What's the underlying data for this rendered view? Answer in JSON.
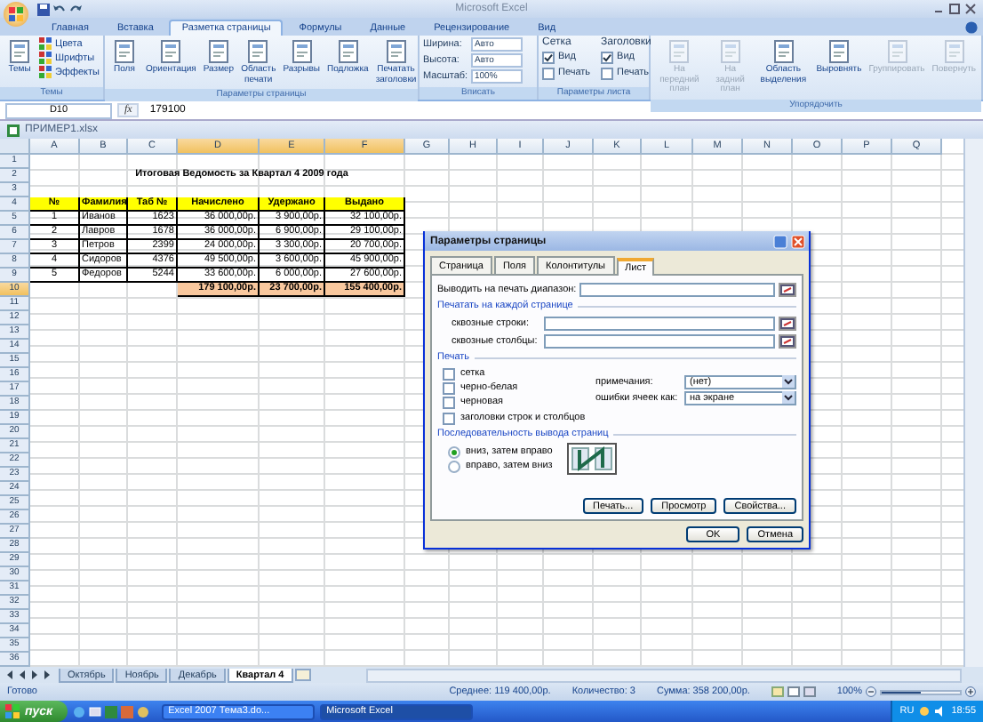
{
  "window": {
    "title": "Microsoft Excel"
  },
  "ribbon": {
    "tabs": [
      {
        "label": "Главная",
        "selected": false
      },
      {
        "label": "Вставка",
        "selected": false
      },
      {
        "label": "Разметка страницы",
        "selected": true
      },
      {
        "label": "Формулы",
        "selected": false
      },
      {
        "label": "Данные",
        "selected": false
      },
      {
        "label": "Рецензирование",
        "selected": false
      },
      {
        "label": "Вид",
        "selected": false
      }
    ],
    "groups": [
      {
        "label": "Темы",
        "items": [
          {
            "kind": "large",
            "label": "Темы",
            "disabled": false
          },
          {
            "kind": "stack",
            "items": [
              {
                "label": "Цвета"
              },
              {
                "label": "Шрифты"
              },
              {
                "label": "Эффекты"
              }
            ]
          }
        ]
      },
      {
        "label": "Параметры страницы",
        "items": [
          {
            "kind": "large",
            "label": "Поля",
            "disabled": false
          },
          {
            "kind": "large",
            "label": "Ориентация",
            "disabled": false
          },
          {
            "kind": "large",
            "label": "Размер",
            "disabled": false
          },
          {
            "kind": "large",
            "label": "Область печати",
            "disabled": false
          },
          {
            "kind": "large",
            "label": "Разрывы",
            "disabled": false
          },
          {
            "kind": "large",
            "label": "Подложка",
            "disabled": false
          },
          {
            "kind": "large",
            "label": "Печатать заголовки",
            "disabled": false
          }
        ]
      },
      {
        "label": "Вписать",
        "items": [
          {
            "kind": "fields",
            "items": [
              {
                "label": "Ширина:",
                "value": "Авто"
              },
              {
                "label": "Высота:",
                "value": "Авто"
              },
              {
                "label": "Масштаб:",
                "value": "100%"
              }
            ]
          }
        ]
      },
      {
        "label": "Параметры листа",
        "items": [
          {
            "kind": "checks",
            "heading": "Сетка",
            "items": [
              {
                "label": "Вид",
                "checked": true
              },
              {
                "label": "Печать",
                "checked": false
              }
            ]
          },
          {
            "kind": "checks",
            "heading": "Заголовки",
            "items": [
              {
                "label": "Вид",
                "checked": true
              },
              {
                "label": "Печать",
                "checked": false
              }
            ]
          }
        ]
      },
      {
        "label": "Упорядочить",
        "items": [
          {
            "kind": "large",
            "label": "На передний план",
            "disabled": true
          },
          {
            "kind": "large",
            "label": "На задний план",
            "disabled": true
          },
          {
            "kind": "large",
            "label": "Область выделения",
            "disabled": false
          },
          {
            "kind": "large",
            "label": "Выровнять",
            "disabled": false
          },
          {
            "kind": "large",
            "label": "Группировать",
            "disabled": true
          },
          {
            "kind": "large",
            "label": "Повернуть",
            "disabled": true
          }
        ]
      }
    ]
  },
  "formula_bar": {
    "name_box": "D10",
    "fx": "fx",
    "value": "179100"
  },
  "workbook": {
    "title": "ПРИМЕР1.xlsx"
  },
  "sheet": {
    "columns": [
      {
        "label": "A",
        "selected": false
      },
      {
        "label": "B",
        "selected": false
      },
      {
        "label": "C",
        "selected": false
      },
      {
        "label": "D",
        "selected": true
      },
      {
        "label": "E",
        "selected": true
      },
      {
        "label": "F",
        "selected": true
      },
      {
        "label": "G",
        "selected": false
      },
      {
        "label": "H",
        "selected": false
      },
      {
        "label": "I",
        "selected": false
      },
      {
        "label": "J",
        "selected": false
      },
      {
        "label": "K",
        "selected": false
      },
      {
        "label": "L",
        "selected": false
      },
      {
        "label": "M",
        "selected": false
      },
      {
        "label": "N",
        "selected": false
      },
      {
        "label": "O",
        "selected": false
      },
      {
        "label": "P",
        "selected": false
      },
      {
        "label": "Q",
        "selected": false
      }
    ],
    "rows": [
      {
        "number": "1",
        "kind": "blank",
        "selected": false
      },
      {
        "number": "2",
        "kind": "title",
        "selected": false,
        "title": "Итоговая Ведомость за Квартал 4 2009 года"
      },
      {
        "number": "3",
        "kind": "blank",
        "selected": false
      },
      {
        "number": "4",
        "kind": "header",
        "selected": false,
        "cells": [
          "№",
          "Фамилия",
          "Таб №",
          "Начислено",
          "Удержано",
          "Выдано"
        ]
      },
      {
        "number": "5",
        "kind": "data",
        "selected": false,
        "cells": [
          "1",
          "Иванов",
          "1623",
          "36 000,00р.",
          "3 900,00р.",
          "32 100,00р."
        ]
      },
      {
        "number": "6",
        "kind": "data",
        "selected": false,
        "cells": [
          "2",
          "Лавров",
          "1678",
          "36 000,00р.",
          "6 900,00р.",
          "29 100,00р."
        ]
      },
      {
        "number": "7",
        "kind": "data",
        "selected": false,
        "cells": [
          "3",
          "Петров",
          "2399",
          "24 000,00р.",
          "3 300,00р.",
          "20 700,00р."
        ]
      },
      {
        "number": "8",
        "kind": "data",
        "selected": false,
        "cells": [
          "4",
          "Сидоров",
          "4376",
          "49 500,00р.",
          "3 600,00р.",
          "45 900,00р."
        ]
      },
      {
        "number": "9",
        "kind": "data",
        "selected": false,
        "cells": [
          "5",
          "Федоров",
          "5244",
          "33 600,00р.",
          "6 000,00р.",
          "27 600,00р."
        ]
      },
      {
        "number": "10",
        "kind": "total",
        "selected": true,
        "cells": [
          "179 100,00р.",
          "23 700,00р.",
          "155 400,00р."
        ]
      },
      {
        "number": "11",
        "kind": "blank",
        "selected": false
      },
      {
        "number": "12",
        "kind": "blank",
        "selected": false
      },
      {
        "number": "13",
        "kind": "blank",
        "selected": false
      },
      {
        "number": "14",
        "kind": "blank",
        "selected": false
      },
      {
        "number": "15",
        "kind": "blank",
        "selected": false
      },
      {
        "number": "16",
        "kind": "blank",
        "selected": false
      },
      {
        "number": "17",
        "kind": "blank",
        "selected": false
      },
      {
        "number": "18",
        "kind": "blank",
        "selected": false
      },
      {
        "number": "19",
        "kind": "blank",
        "selected": false
      },
      {
        "number": "20",
        "kind": "blank",
        "selected": false
      },
      {
        "number": "21",
        "kind": "blank",
        "selected": false
      },
      {
        "number": "22",
        "kind": "blank",
        "selected": false
      },
      {
        "number": "23",
        "kind": "blank",
        "selected": false
      },
      {
        "number": "24",
        "kind": "blank",
        "selected": false
      },
      {
        "number": "25",
        "kind": "blank",
        "selected": false
      },
      {
        "number": "26",
        "kind": "blank",
        "selected": false
      },
      {
        "number": "27",
        "kind": "blank",
        "selected": false
      },
      {
        "number": "28",
        "kind": "blank",
        "selected": false
      },
      {
        "number": "29",
        "kind": "blank",
        "selected": false
      },
      {
        "number": "30",
        "kind": "blank",
        "selected": false
      },
      {
        "number": "31",
        "kind": "blank",
        "selected": false
      },
      {
        "number": "32",
        "kind": "blank",
        "selected": false
      },
      {
        "number": "33",
        "kind": "blank",
        "selected": false
      },
      {
        "number": "34",
        "kind": "blank",
        "selected": false
      },
      {
        "number": "35",
        "kind": "blank",
        "selected": false
      },
      {
        "number": "36",
        "kind": "blank",
        "selected": false
      }
    ]
  },
  "sheet_tabs": [
    {
      "label": "Октябрь",
      "selected": false
    },
    {
      "label": "Ноябрь",
      "selected": false
    },
    {
      "label": "Декабрь",
      "selected": false
    },
    {
      "label": "Квартал 4",
      "selected": true
    }
  ],
  "dialog": {
    "title": "Параметры страницы",
    "tabs": [
      {
        "label": "Страница",
        "selected": false
      },
      {
        "label": "Поля",
        "selected": false
      },
      {
        "label": "Колонтитулы",
        "selected": false
      },
      {
        "label": "Лист",
        "selected": true
      }
    ],
    "print_area": {
      "label": "Выводить на печать диапазон:"
    },
    "print_titles": {
      "heading": "Печатать на каждой странице",
      "fields": [
        {
          "label": "сквозные строки:"
        },
        {
          "label": "сквозные столбцы:"
        }
      ]
    },
    "print": {
      "heading": "Печать",
      "checkboxes": [
        {
          "label": "сетка",
          "checked": false
        },
        {
          "label": "черно-белая",
          "checked": false
        },
        {
          "label": "черновая",
          "checked": false
        },
        {
          "label": "заголовки строк и столбцов",
          "checked": false
        }
      ],
      "selects": [
        {
          "label": "примечания:",
          "value": "(нет)"
        },
        {
          "label": "ошибки ячеек как:",
          "value": "на экране"
        }
      ]
    },
    "page_order": {
      "heading": "Последовательность вывода страниц",
      "options": [
        {
          "label": "вниз, затем вправо",
          "selected": true
        },
        {
          "label": "вправо, затем вниз",
          "selected": false
        }
      ]
    },
    "buttons": [
      "Печать...",
      "Просмотр",
      "Свойства..."
    ],
    "footer_buttons": [
      "OK",
      "Отмена"
    ]
  },
  "status_bar": {
    "status": "Готово",
    "average": "Среднее: 119 400,00р.",
    "count": "Количество: 3",
    "sum": "Сумма: 358 200,00р.",
    "zoom": "100%",
    "zoom_slider": {
      "level": 0.5
    }
  },
  "taskbar": {
    "start": "пуск",
    "windows": [
      {
        "label": "Excel 2007 Тема3.do...",
        "selected": false
      },
      {
        "label": "Microsoft Excel",
        "selected": true
      }
    ],
    "language": "RU",
    "clock": "18:55"
  }
}
